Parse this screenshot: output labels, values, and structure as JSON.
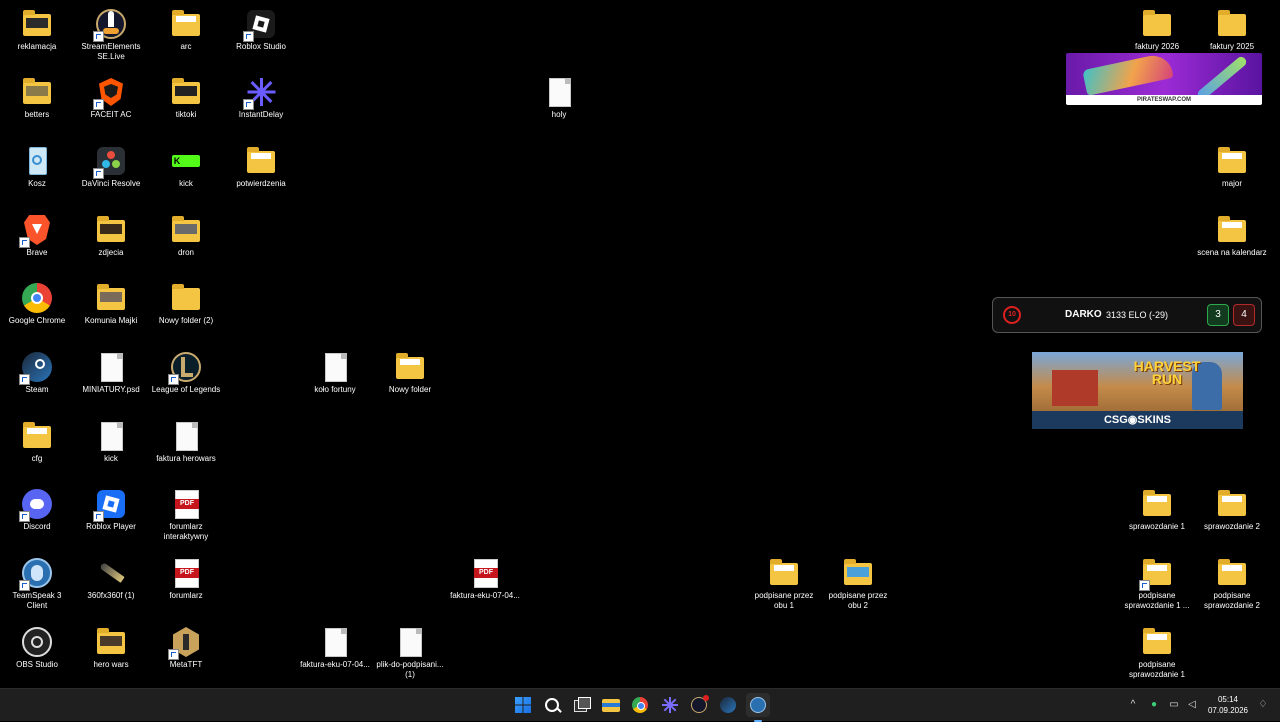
{
  "desktop_icons": [
    {
      "label": "reklamacja"
    },
    {
      "label": "StreamElements SE.Live"
    },
    {
      "label": "arc"
    },
    {
      "label": "Roblox Studio"
    },
    {
      "label": "betters"
    },
    {
      "label": "FACEIT AC"
    },
    {
      "label": "tiktoki"
    },
    {
      "label": "InstantDelay"
    },
    {
      "label": "holy"
    },
    {
      "label": "Kosz"
    },
    {
      "label": "DaVinci Resolve"
    },
    {
      "label": "kick"
    },
    {
      "label": "potwierdzenia"
    },
    {
      "label": "Brave"
    },
    {
      "label": "zdjecia"
    },
    {
      "label": "dron"
    },
    {
      "label": "Google Chrome"
    },
    {
      "label": "Komunia Majki"
    },
    {
      "label": "Nowy folder (2)"
    },
    {
      "label": "Steam"
    },
    {
      "label": "MINIATURY.psd"
    },
    {
      "label": "League of Legends"
    },
    {
      "label": "koło fortuny"
    },
    {
      "label": "Nowy folder"
    },
    {
      "label": "cfg"
    },
    {
      "label": "kick"
    },
    {
      "label": "faktura herowars"
    },
    {
      "label": "Discord"
    },
    {
      "label": "Roblox Player"
    },
    {
      "label": "forumlarz interaktywny"
    },
    {
      "label": "TeamSpeak 3 Client"
    },
    {
      "label": "360fx360f (1)"
    },
    {
      "label": "forumlarz"
    },
    {
      "label": "faktura-eku-07-04..."
    },
    {
      "label": "podpisane przez obu 1"
    },
    {
      "label": "podpisane przez obu 2"
    },
    {
      "label": "OBS Studio"
    },
    {
      "label": "hero wars"
    },
    {
      "label": "MetaTFT"
    },
    {
      "label": "faktura-eku-07-04..."
    },
    {
      "label": "plik-do-podpisani... (1)"
    },
    {
      "label": "faktury 2026"
    },
    {
      "label": "faktury 2025"
    },
    {
      "label": "major"
    },
    {
      "label": "scena na kalendarz"
    },
    {
      "label": "sprawozdanie 1"
    },
    {
      "label": "sprawozdanie 2"
    },
    {
      "label": "podpisane sprawozdanie 1 ..."
    },
    {
      "label": "podpisane sprawozdanie 2"
    },
    {
      "label": "podpisane sprawozdanie 1"
    }
  ],
  "icon_labels": {
    "pdf": "PDF",
    "davinci": "",
    "kick_logo": "K"
  },
  "ads": {
    "pirateswap_brand": "PIRATESWAP.COM",
    "harvest_title": "HARVEST RUN",
    "csgoskins_brand": "CSG◉SKINS"
  },
  "faceit_widget": {
    "level": "10",
    "name": "DARKO",
    "elo": "3133 ELO (-29)",
    "wins": "3",
    "losses": "4"
  },
  "taskbar": {
    "apps": [
      "windows-start-icon",
      "search-icon",
      "task-view-icon",
      "file-explorer-icon",
      "chrome-icon",
      "instantdelay-icon",
      "streamelements-icon",
      "steam-icon",
      "teamspeak-icon"
    ]
  },
  "clock": {
    "time": "05:14",
    "date": "07.09.2026"
  },
  "colors": {
    "folder": "#f4c542",
    "taskbar": "#1f1f1f",
    "faceit_red": "#e02020"
  }
}
